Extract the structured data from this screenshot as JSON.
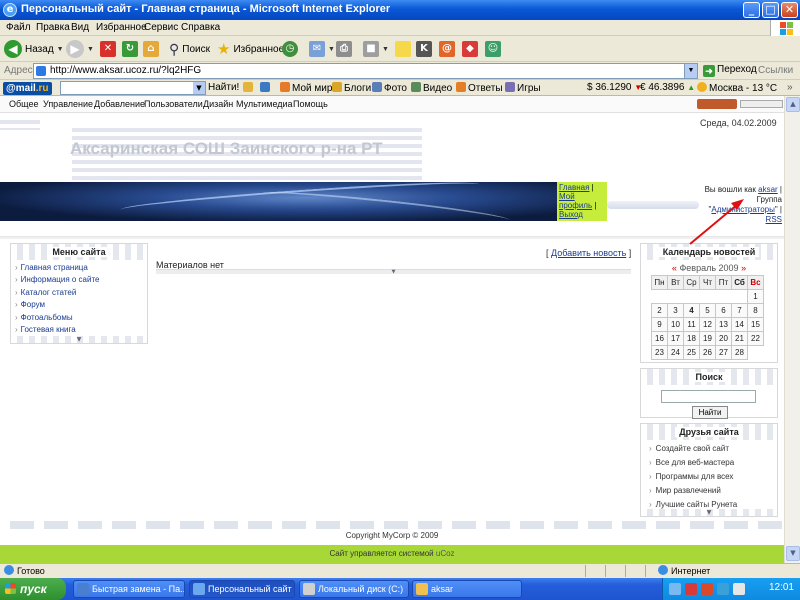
{
  "window": {
    "title": "Персональный сайт - Главная страница - Microsoft Internet Explorer",
    "buttons": {
      "minimize": "_",
      "maximize": "□",
      "close": "✕"
    }
  },
  "menu": [
    "Файл",
    "Правка",
    "Вид",
    "Избранное",
    "Сервис",
    "Справка"
  ],
  "toolbar": {
    "back": "Назад",
    "search": "Поиск",
    "favorites": "Избранное"
  },
  "address": {
    "label": "Адрес:",
    "url": "http://www.aksar.ucoz.ru/?lq2HFG",
    "go": "Переход",
    "links": "Ссылки"
  },
  "mailbar": {
    "logo_a": "@mail",
    "logo_b": ".ru",
    "find": "Найти!",
    "items": [
      "Мой мир",
      "Блоги",
      "Фото",
      "Видео",
      "Ответы",
      "Игры"
    ],
    "usd": "$ 36.1290",
    "eur": "€ 46.3896",
    "weather": "Москва - 13 °C"
  },
  "sitenav": [
    "Общее",
    "Управление",
    "Добавление",
    "Пользователи",
    "Дизайн",
    "Мультимедиа",
    "Помощь"
  ],
  "site": {
    "date": "Среда, 04.02.2009",
    "title": "Аксаринская СОШ Заинского р-на РТ",
    "user_links": [
      "Главная",
      "Мой профиль",
      "Выход"
    ],
    "user_prefix": "Вы вошли как",
    "user_name": "aksar",
    "group_label": "Группа",
    "group_name": "Администраторы",
    "rss": "RSS"
  },
  "site_menu": {
    "title": "Меню сайта",
    "items": [
      "Главная страница",
      "Информация о сайте",
      "Каталог статей",
      "Форум",
      "Фотоальбомы",
      "Гостевая книга"
    ]
  },
  "content": {
    "add_news": "Добавить новость",
    "empty": "Материалов нет"
  },
  "calendar": {
    "title": "Календарь новостей",
    "month": "Февраль 2009",
    "prev": "«",
    "next": "»",
    "days": [
      "Пн",
      "Вт",
      "Ср",
      "Чт",
      "Пт",
      "Сб",
      "Вс"
    ],
    "weeks": [
      [
        "",
        "",
        "",
        "",
        "",
        "",
        "1"
      ],
      [
        "2",
        "3",
        "4",
        "5",
        "6",
        "7",
        "8"
      ],
      [
        "9",
        "10",
        "11",
        "12",
        "13",
        "14",
        "15"
      ],
      [
        "16",
        "17",
        "18",
        "19",
        "20",
        "21",
        "22"
      ],
      [
        "23",
        "24",
        "25",
        "26",
        "27",
        "28",
        ""
      ]
    ]
  },
  "search": {
    "title": "Поиск",
    "button": "Найти"
  },
  "friends": {
    "title": "Друзья сайта",
    "items": [
      "Создайте свой сайт",
      "Все для веб-мастера",
      "Программы для всех",
      "Мир развлечений",
      "Лучшие сайты Рунета"
    ]
  },
  "footer": {
    "copyright": "Copyright MyCorp © 2009",
    "powered_prefix": "Сайт управляется системой",
    "powered_brand": "uCoz"
  },
  "status": {
    "left": "Готово",
    "zone": "Интернет"
  },
  "taskbar": {
    "start": "пуск",
    "windows": [
      "Быстрая замена - Па...",
      "Персональный сайт ...",
      "Локальный диск (C:)",
      "aksar"
    ],
    "clock": "12:01"
  },
  "colors": {
    "title_blue": "#0a58d6",
    "header_green": "#c6ed3b",
    "footer_green": "#a8d838",
    "link_blue": "#1a3b8f",
    "annotation_red": "#e01010"
  }
}
